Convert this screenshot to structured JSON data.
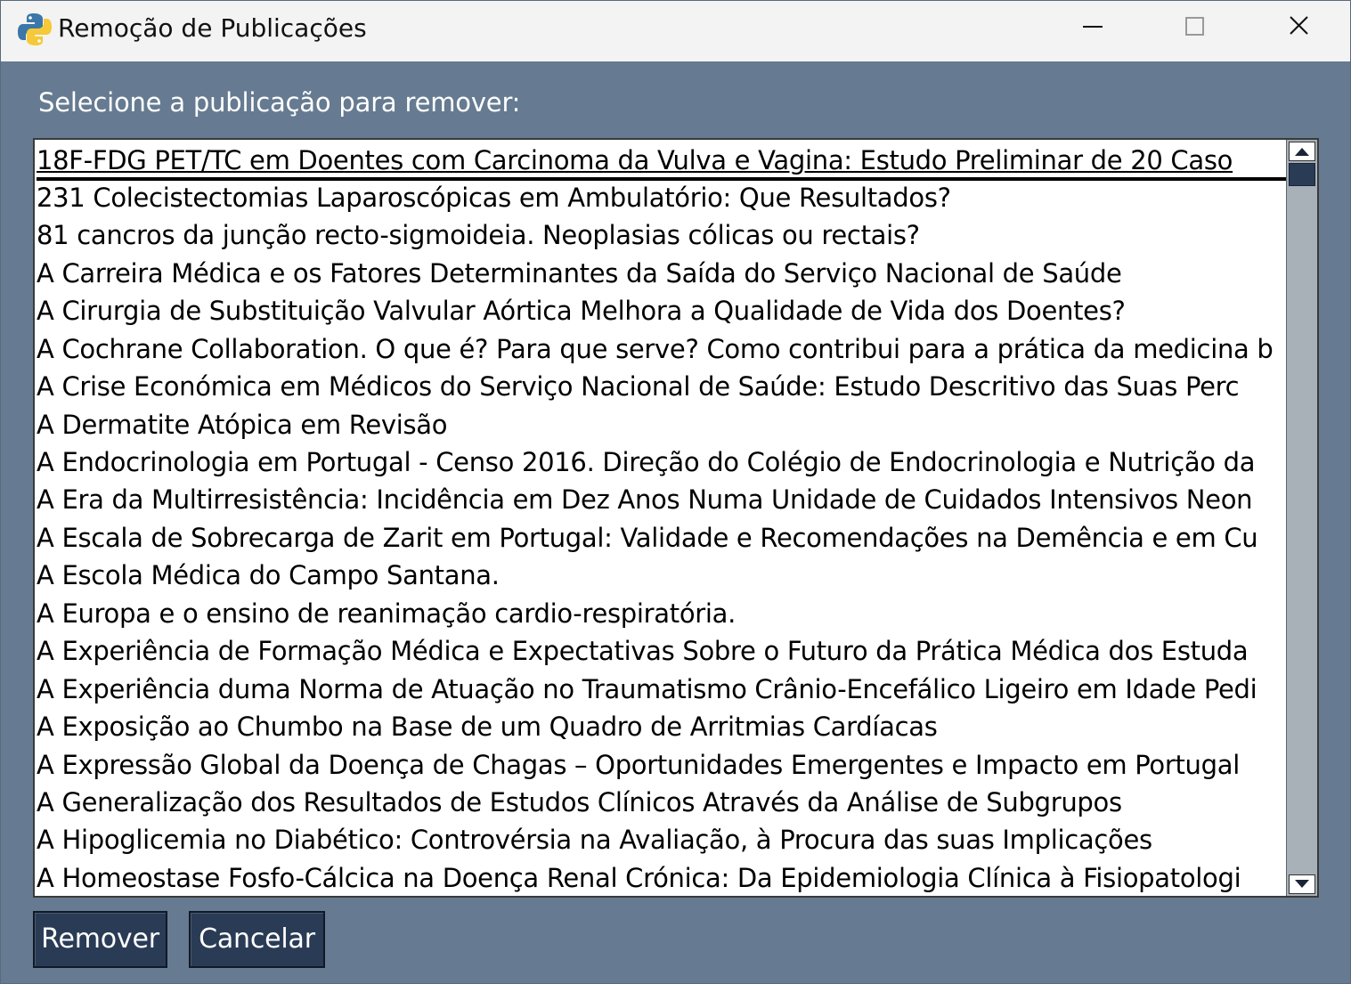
{
  "window": {
    "title": "Remoção de Publicações"
  },
  "prompt": {
    "label": "Selecione a publicação para remover:"
  },
  "list": {
    "selected_index": 0,
    "items": [
      "18F-FDG PET/TC em Doentes com Carcinoma da Vulva e Vagina: Estudo Preliminar de 20 Caso",
      "231 Colecistectomias Laparoscópicas em Ambulatório: Que Resultados?",
      "81 cancros da junção recto-sigmoideia. Neoplasias cólicas ou rectais?",
      "A Carreira Médica e os Fatores Determinantes da Saída do Serviço Nacional de Saúde",
      "A Cirurgia de Substituição Valvular Aórtica Melhora a Qualidade de Vida dos Doentes?",
      "A Cochrane Collaboration. O que é? Para que serve? Como contribui para a prática da medicina b",
      "A Crise Económica em Médicos do Serviço Nacional de Saúde: Estudo Descritivo das Suas Perc",
      "A Dermatite Atópica em Revisão",
      "A Endocrinologia em Portugal - Censo 2016. Direção do Colégio de Endocrinologia e Nutrição da",
      "A Era da Multirresistência: Incidência em Dez Anos Numa Unidade de Cuidados Intensivos Neon",
      "A Escala de Sobrecarga de Zarit em Portugal: Validade e Recomendações na Demência e em Cu",
      "A Escola Médica do Campo Santana.",
      "A Europa e o ensino de reanimação cardio-respiratória.",
      "A Experiência de Formação Médica e Expectativas Sobre o Futuro da Prática Médica dos Estuda",
      "A Experiência duma Norma de Atuação no Traumatismo Crânio-Encefálico Ligeiro em Idade Pedi",
      "A Exposição ao Chumbo na Base de um Quadro de Arritmias Cardíacas",
      "A Expressão Global da Doença de Chagas – Oportunidades Emergentes e Impacto em Portugal",
      "A Generalização dos Resultados de Estudos Clínicos Através da Análise de Subgrupos",
      "A Hipoglicemia no Diabético: Controvérsia na Avaliação, à Procura das suas Implicações",
      "A Homeostase Fosfo-Cálcica na Doença Renal Crónica: Da Epidemiologia Clínica à Fisiopatologi"
    ]
  },
  "buttons": {
    "remove_label": "Remover",
    "cancel_label": "Cancelar"
  },
  "colors": {
    "window_bg": "#667b91",
    "button_bg": "#2a3b55",
    "titlebar_bg": "#f3f3f3"
  },
  "icons": {
    "app": "python-icon",
    "minimize": "minimize-icon",
    "maximize": "maximize-icon",
    "close": "close-icon"
  }
}
